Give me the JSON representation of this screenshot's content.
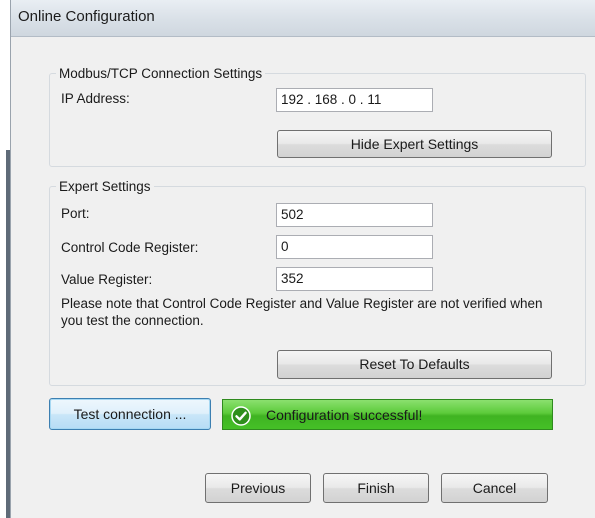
{
  "window": {
    "title": "Online Configuration"
  },
  "modbus_group": {
    "title": "Modbus/TCP Connection Settings",
    "ip_label": "IP Address:",
    "ip_value": "192 . 168 . 0 . 11",
    "hide_expert_label": "Hide Expert Settings"
  },
  "expert_group": {
    "title": "Expert Settings",
    "port_label": "Port:",
    "port_value": "502",
    "control_label": "Control Code Register:",
    "control_value": "0",
    "value_label": "Value Register:",
    "value_value": "352",
    "note": "Please note that Control Code Register and Value Register are not verified when you test the connection.",
    "reset_label": "Reset To Defaults"
  },
  "test": {
    "button_label": "Test connection ...",
    "status_text": "Configuration successful!",
    "status_icon": "checkmark-icon",
    "status_color": "#4cc22e"
  },
  "footer": {
    "previous_label": "Previous",
    "finish_label": "Finish",
    "cancel_label": "Cancel"
  }
}
